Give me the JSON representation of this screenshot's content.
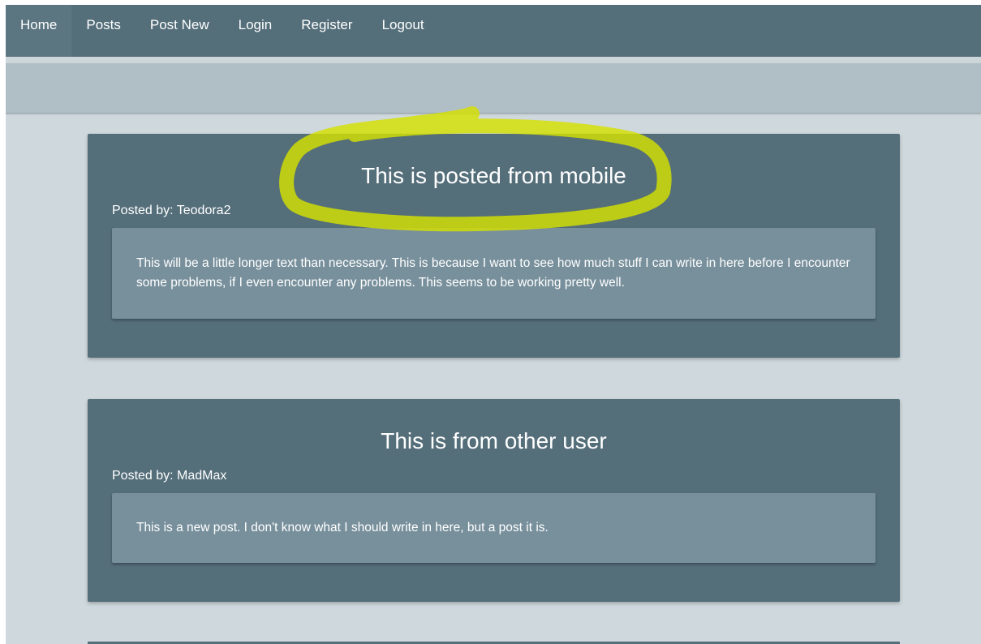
{
  "nav": {
    "items": [
      {
        "label": "Home",
        "active": true
      },
      {
        "label": "Posts",
        "active": false
      },
      {
        "label": "Post New",
        "active": false
      },
      {
        "label": "Login",
        "active": false
      },
      {
        "label": "Register",
        "active": false
      },
      {
        "label": "Logout",
        "active": false
      }
    ]
  },
  "posts": [
    {
      "title": "This is posted from mobile",
      "author": "Posted by: Teodora2",
      "body": "This will be a little longer text than necessary. This is because I want to see how much stuff I can write in here before I encounter some problems, if I even encounter any problems. This seems to be working pretty well."
    },
    {
      "title": "This is from other user",
      "author": "Posted by: MadMax",
      "body": "This is a new post. I don't know what I should write in here, but a post it is."
    }
  ],
  "colors": {
    "navbar": "#546e7a",
    "subbar": "#b0bec5",
    "page_bg": "#cfd8dc",
    "post_card": "#546e7a",
    "post_body": "#78909c",
    "highlight_marker": "#d4e000"
  }
}
